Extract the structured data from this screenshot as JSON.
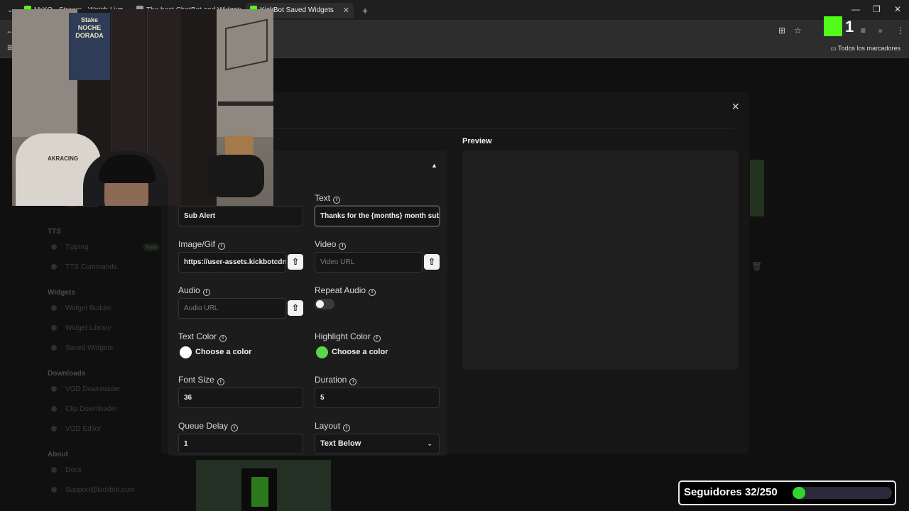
{
  "browser": {
    "tabs": [
      {
        "label": "MrXO - Stream - Watch Live",
        "icon_color": "#53fc18"
      },
      {
        "label": "The best ChatBot and Widgets",
        "icon_color": "#9a9a9a"
      },
      {
        "label": "KickBot Saved Widgets",
        "icon_color": "#53fc18"
      }
    ],
    "new_tab": "+",
    "bookmarks_label": "Todos los marcadores"
  },
  "sidebar": {
    "items_top": [
      {
        "label": "Sub Alerts"
      }
    ],
    "sections": [
      {
        "heading": "TTS",
        "items": [
          {
            "label": "Tipping",
            "badge": "New"
          },
          {
            "label": "TTS Commands"
          }
        ]
      },
      {
        "heading": "Widgets",
        "items": [
          {
            "label": "Widget Builder"
          },
          {
            "label": "Widget Library"
          },
          {
            "label": "Saved Widgets"
          }
        ]
      },
      {
        "heading": "Downloads",
        "items": [
          {
            "label": "VOD Downloader"
          },
          {
            "label": "Clip Downloader"
          },
          {
            "label": "VOD Editor"
          }
        ]
      },
      {
        "heading": "About",
        "items": [
          {
            "label": "Docs"
          },
          {
            "label": "Support@kickbot.com"
          }
        ]
      }
    ]
  },
  "modal": {
    "close_icon": "close-icon",
    "preview_label": "Preview",
    "fields": {
      "name_value": "Sub Alert",
      "text_label": "Text",
      "text_value": "Thanks for the {months} month sub",
      "image_label": "Image/Gif",
      "image_value": "https://user-assets.kickbotcdn.c",
      "video_label": "Video",
      "video_placeholder": "Video URL",
      "audio_label": "Audio",
      "audio_placeholder": "Audio URL",
      "repeat_audio_label": "Repeat Audio",
      "repeat_audio_on": false,
      "text_color_label": "Text Color",
      "text_color_action": "Choose a color",
      "text_color_value": "#ffffff",
      "highlight_color_label": "Highlight Color",
      "highlight_color_action": "Choose a color",
      "highlight_color_value": "#59d64a",
      "font_size_label": "Font Size",
      "font_size_value": "36",
      "duration_label": "Duration",
      "duration_value": "5",
      "queue_delay_label": "Queue Delay",
      "queue_delay_value": "1",
      "layout_label": "Layout",
      "layout_value": "Text Below"
    }
  },
  "overlay": {
    "webcam_banner": "Stake\nNOCHE\nDORADA",
    "webcam_chair_text": "AKRACING",
    "kick_count": "1",
    "followers_text": "Seguidores 32/250",
    "followers_current": 32,
    "followers_goal": 250
  },
  "colors": {
    "accent": "#53fc18",
    "followers_fill": "#34d52c"
  }
}
